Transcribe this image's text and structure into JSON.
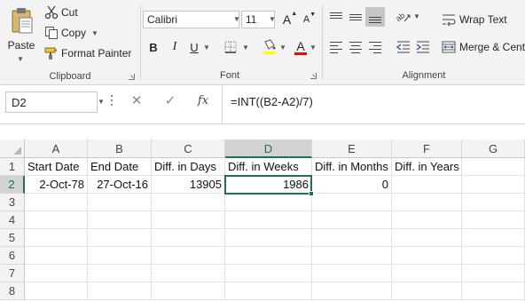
{
  "ribbon": {
    "clipboard": {
      "paste_label": "Paste",
      "cut_label": "Cut",
      "copy_label": "Copy",
      "format_painter_label": "Format Painter",
      "group_label": "Clipboard"
    },
    "font": {
      "font_name": "Calibri",
      "font_size": "11",
      "bold": "B",
      "italic": "I",
      "underline": "U",
      "font_color_letter": "A",
      "grow_letter": "A",
      "shrink_letter": "A",
      "group_label": "Font",
      "highlight_color": "#ffff00",
      "font_color": "#ff0000"
    },
    "alignment": {
      "wrap_text_label": "Wrap Text",
      "merge_center_label": "Merge & Cent",
      "group_label": "Alignment"
    }
  },
  "formula_bar": {
    "name_box": "D2",
    "fx_label": "fx",
    "formula": "=INT((B2-A2)/7)"
  },
  "sheet": {
    "columns": [
      "A",
      "B",
      "C",
      "D",
      "E",
      "F",
      "G"
    ],
    "rows": [
      "1",
      "2",
      "3",
      "4",
      "5",
      "6",
      "7",
      "8"
    ],
    "cells": {
      "A1": "Start Date",
      "B1": "End Date",
      "C1": "Diff. in Days",
      "D1": "Diff. in Weeks",
      "E1": "Diff. in Months",
      "F1": "Diff. in Years",
      "A2": "2-Oct-78",
      "B2": "27-Oct-16",
      "C2": "13905",
      "D2": "1986",
      "E2": "0"
    },
    "active_cell": "D2",
    "accent_color": "#217346"
  }
}
